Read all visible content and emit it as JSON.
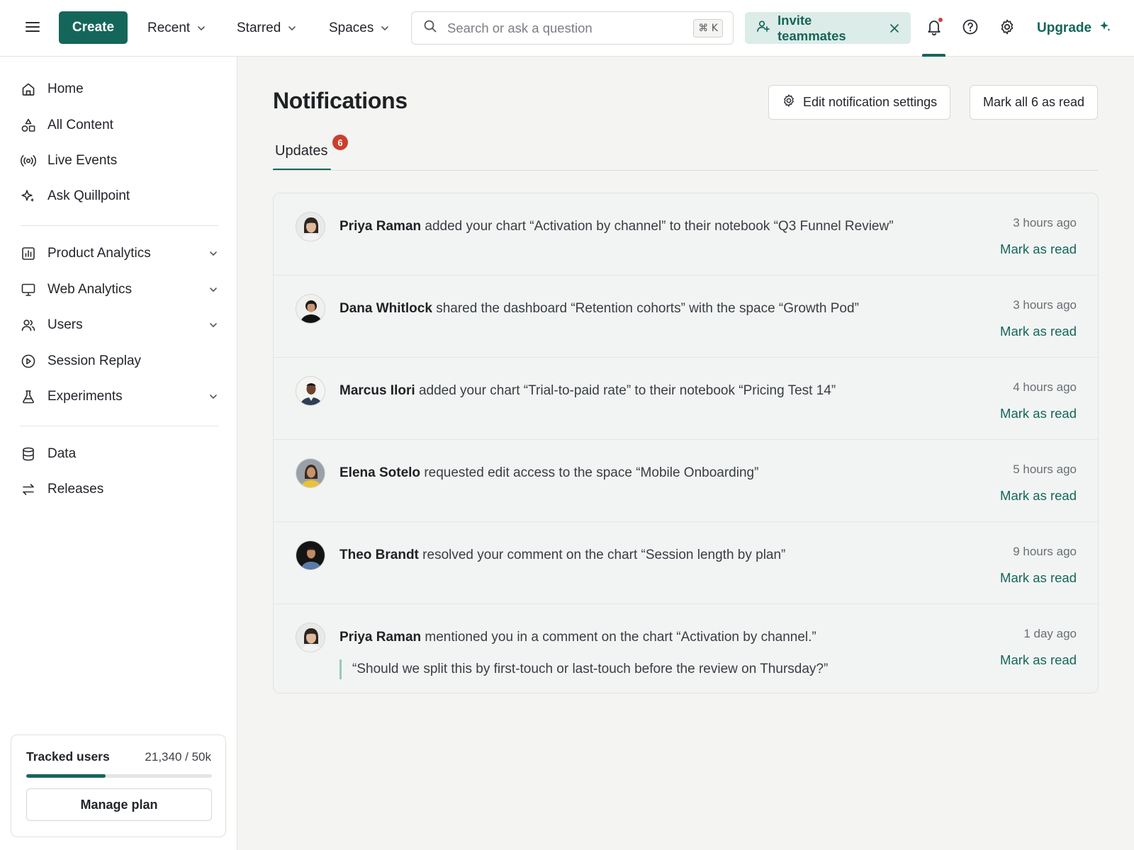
{
  "topbar": {
    "create_label": "Create",
    "nav": [
      {
        "label": "Recent"
      },
      {
        "label": "Starred"
      },
      {
        "label": "Spaces"
      }
    ],
    "search_placeholder": "Search or ask a question",
    "search_shortcut": "⌘ K",
    "invite_label": "Invite teammates",
    "upgrade_label": "Upgrade",
    "icons": [
      "menu-icon",
      "search-icon",
      "add-user-icon",
      "close-icon",
      "bell-icon",
      "help-icon",
      "gear-icon",
      "sparkle-icon"
    ]
  },
  "sidebar": {
    "primary": [
      {
        "label": "Home",
        "icon": "home-icon"
      },
      {
        "label": "All Content",
        "icon": "shapes-icon"
      },
      {
        "label": "Live Events",
        "icon": "broadcast-icon"
      },
      {
        "label": "Ask Quillpoint",
        "icon": "sparkle-icon"
      }
    ],
    "sections": [
      {
        "label": "Product Analytics",
        "icon": "bar-chart-icon",
        "expandable": true
      },
      {
        "label": "Web Analytics",
        "icon": "monitor-icon",
        "expandable": true
      },
      {
        "label": "Users",
        "icon": "users-icon",
        "expandable": true
      },
      {
        "label": "Session Replay",
        "icon": "play-circle-icon",
        "expandable": false
      },
      {
        "label": "Experiments",
        "icon": "flask-icon",
        "expandable": true
      }
    ],
    "footer": [
      {
        "label": "Data",
        "icon": "database-icon"
      },
      {
        "label": "Releases",
        "icon": "arrows-icon"
      }
    ],
    "tracked_users": {
      "label": "Tracked users",
      "count_text": "21,340 / 50k",
      "used_fraction": 0.4268,
      "manage_label": "Manage plan"
    }
  },
  "main": {
    "title": "Notifications",
    "edit_settings_label": "Edit notification settings",
    "mark_all_label": "Mark all 6 as read",
    "tab": {
      "label": "Updates",
      "badge": "6"
    },
    "notifications": [
      {
        "actor": "Priya Raman",
        "text": "added your chart “Activation by channel” to their notebook “Q3 Funnel Review”",
        "time": "3 hours ago",
        "action": "Mark as read"
      },
      {
        "actor": "Dana Whitlock",
        "text": "shared the dashboard “Retention cohorts” with the space “Growth Pod”",
        "time": "3 hours ago",
        "action": "Mark as read"
      },
      {
        "actor": "Marcus Ilori",
        "text": "added your chart “Trial-to-paid rate” to their notebook “Pricing Test 14”",
        "time": "4 hours ago",
        "action": "Mark as read"
      },
      {
        "actor": "Elena Sotelo",
        "text": "requested edit access to the space “Mobile Onboarding”",
        "time": "5 hours ago",
        "action": "Mark as read"
      },
      {
        "actor": "Theo Brandt",
        "text": "resolved your comment on the chart “Session length by plan”",
        "time": "9 hours ago",
        "action": "Mark as read"
      },
      {
        "actor": "Priya Raman",
        "text": "mentioned you in a comment on the chart “Activation by channel.”",
        "quote": "“Should we split this by first-touch or last-touch before the review on Thursday?”",
        "time": "1 day ago",
        "action": "Mark as read"
      }
    ]
  },
  "colors": {
    "accent": "#15665a",
    "accent_soft": "#dcece8",
    "badge": "#c9412d",
    "notification_dot": "#d6403a",
    "card_background": "#f1f4f3"
  }
}
